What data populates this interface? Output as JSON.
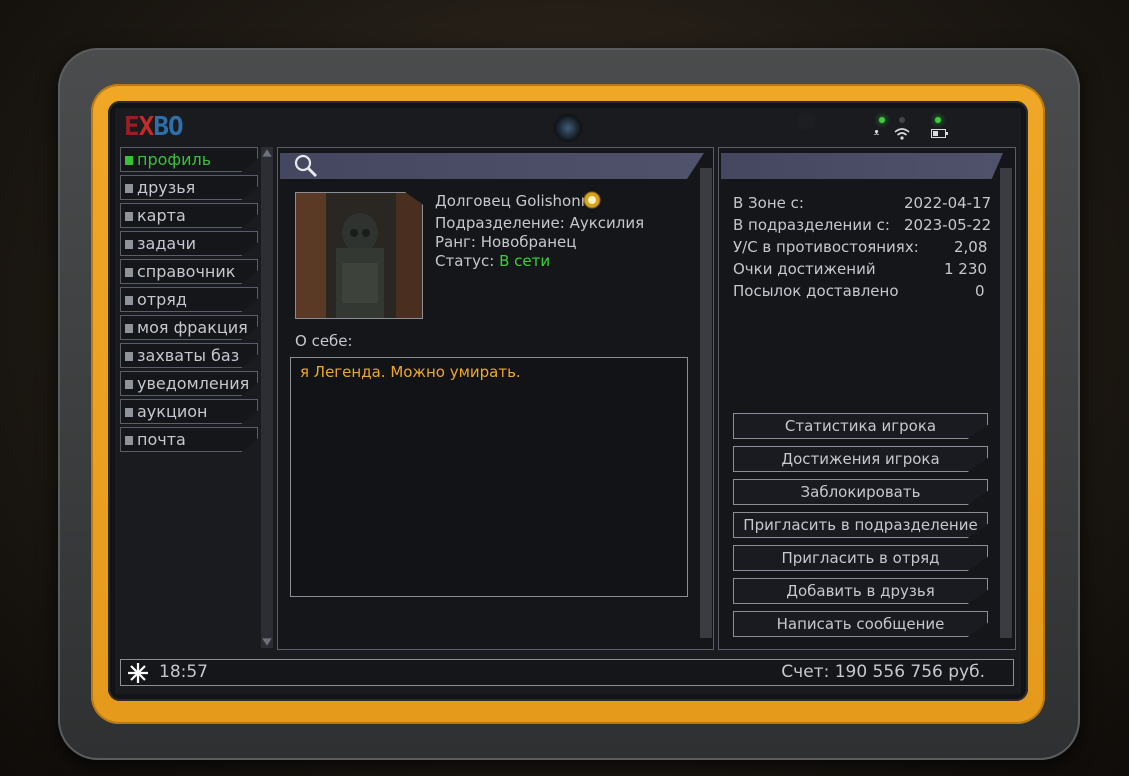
{
  "logo": {
    "e": "E",
    "x": "X",
    "rest": "BO"
  },
  "nav": {
    "items": [
      {
        "label": "профиль",
        "active": true
      },
      {
        "label": "друзья"
      },
      {
        "label": "карта"
      },
      {
        "label": "задачи"
      },
      {
        "label": "справочник"
      },
      {
        "label": "отряд"
      },
      {
        "label": "моя фракция"
      },
      {
        "label": "захваты баз"
      },
      {
        "label": "уведомления"
      },
      {
        "label": "аукцион"
      },
      {
        "label": "почта"
      }
    ]
  },
  "profile": {
    "name": "Долговец Golishonn",
    "division_label": "Подразделение:",
    "division": "Ауксилия",
    "rank_label": "Ранг:",
    "rank": "Новобранец",
    "status_label": "Статус:",
    "status": "В сети",
    "about_label": "О себе:",
    "about": "я Легенда. Можно умирать."
  },
  "stats": [
    {
      "label": "В Зоне с:",
      "value": "2022-04-17"
    },
    {
      "label": "В подразделении с:",
      "value": "2023-05-22"
    },
    {
      "label": "У/С в противостояниях:",
      "value": "2,08"
    },
    {
      "label": "Очки достижений",
      "value": "1 230"
    },
    {
      "label": "Посылок доставлено",
      "value": "0"
    }
  ],
  "actions": [
    "Статистика игрока",
    "Достижения игрока",
    "Заблокировать",
    "Пригласить в подразделение",
    "Пригласить в отряд",
    "Добавить в друзья",
    "Написать сообщение"
  ],
  "statusbar": {
    "time": "18:57",
    "balance": "Счет: 190 556 756 руб."
  },
  "colors": {
    "accent_green": "#39d13a",
    "device_yellow": "#f0a726",
    "text": "#c5c8ce"
  }
}
